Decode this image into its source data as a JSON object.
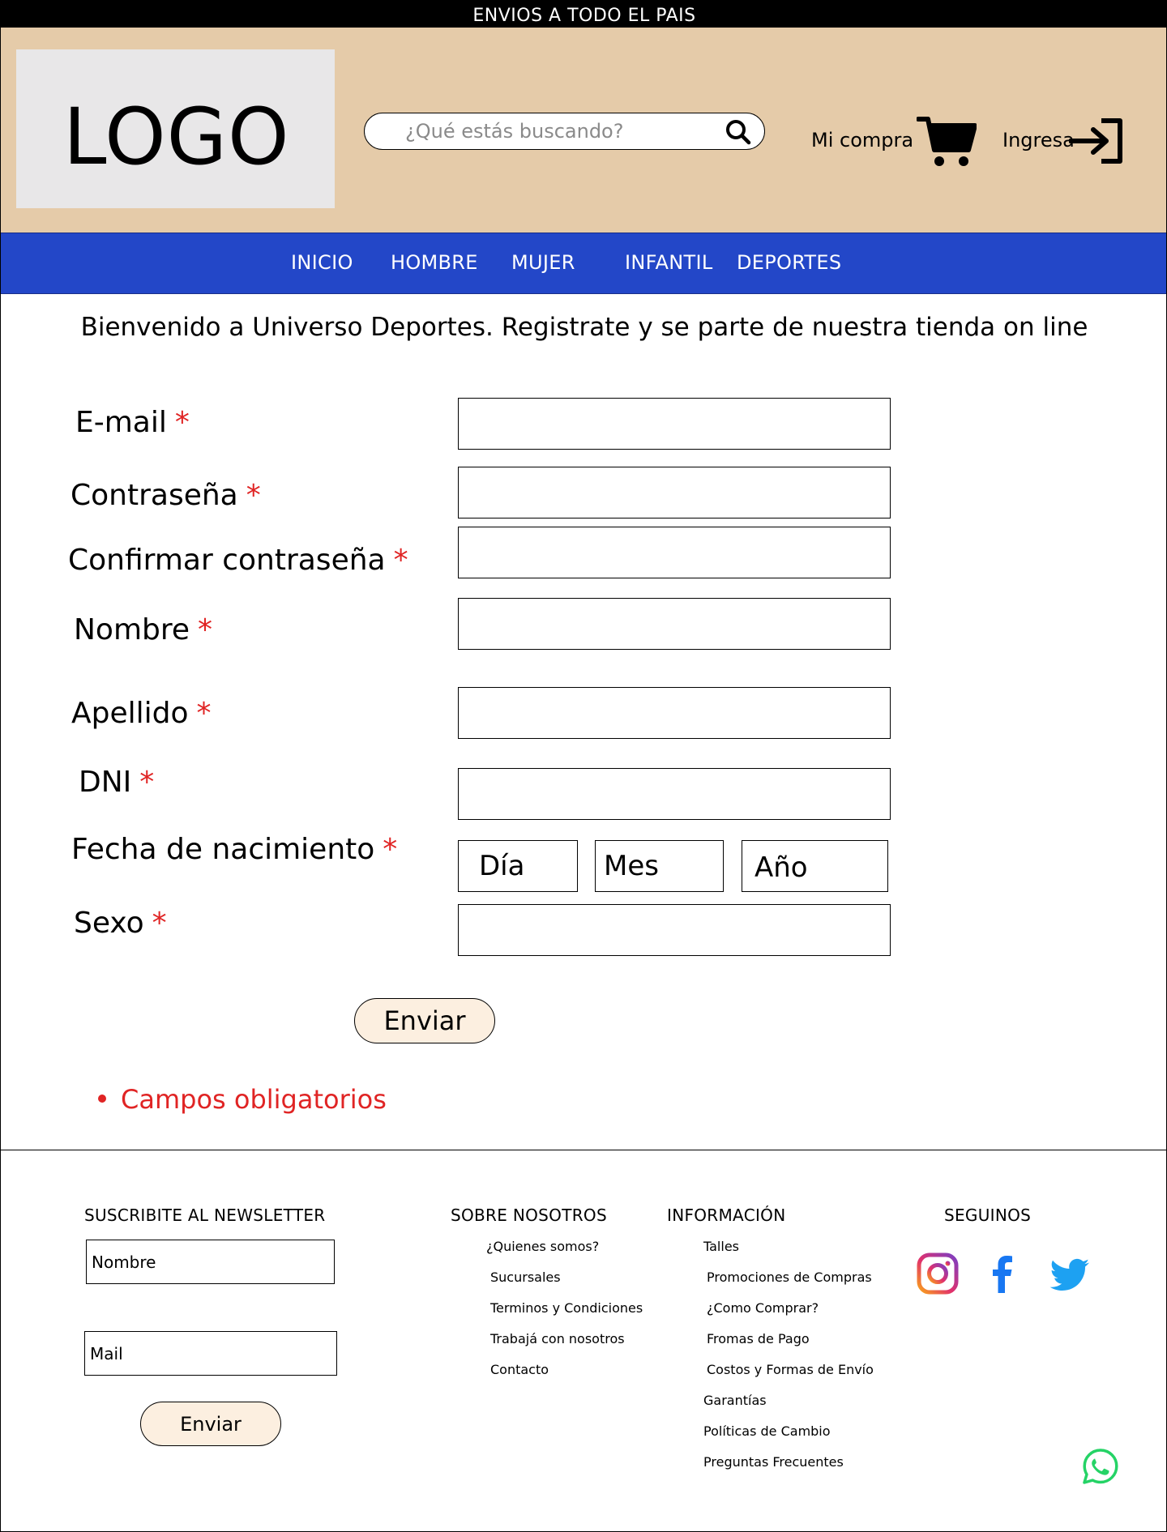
{
  "topbar": {
    "text": "ENVIOS A TODO EL PAIS"
  },
  "header": {
    "logo": "LOGO",
    "search_placeholder": "¿Qué estás buscando?",
    "cart_label": "Mi compra",
    "login_label": "Ingresa"
  },
  "nav": {
    "items": [
      {
        "label": "INICIO"
      },
      {
        "label": "HOMBRE"
      },
      {
        "label": "MUJER"
      },
      {
        "label": "INFANTIL"
      },
      {
        "label": "DEPORTES"
      }
    ]
  },
  "welcome": "Bienvenido a Universo Deportes. Registrate y se parte de nuestra tienda on line",
  "form": {
    "required_mark": "*",
    "fields": [
      {
        "label": "E-mail"
      },
      {
        "label": "Contraseña"
      },
      {
        "label": "Confirmar contraseña"
      },
      {
        "label": "Nombre"
      },
      {
        "label": "Apellido"
      },
      {
        "label": "DNI"
      },
      {
        "label": "Fecha de nacimiento"
      },
      {
        "label": "Sexo"
      }
    ],
    "date": {
      "day": "Día",
      "month": "Mes",
      "year": "Año"
    },
    "submit": "Enviar",
    "required_note": "Campos obligatorios"
  },
  "footer": {
    "newsletter": {
      "title": "SUSCRIBITE AL NEWSLETTER",
      "name_placeholder": "Nombre",
      "mail_placeholder": "Mail",
      "button": "Enviar"
    },
    "about": {
      "title": "SOBRE NOSOTROS",
      "links": [
        "¿Quienes somos?",
        "Sucursales",
        "Terminos y Condiciones",
        "Trabajá con nosotros",
        "Contacto"
      ]
    },
    "info": {
      "title": "INFORMACIÓN",
      "links": [
        "Talles",
        "Promociones de Compras",
        "¿Como Comprar?",
        "Fromas de Pago",
        "Costos y Formas de Envío",
        "Garantías",
        "Políticas de Cambio",
        "Preguntas Frecuentes"
      ]
    },
    "social": {
      "title": "SEGUINOS",
      "icons": [
        "instagram-icon",
        "facebook-icon",
        "twitter-icon"
      ]
    },
    "whatsapp_icon": "whatsapp-icon"
  },
  "colors": {
    "header_bg": "#e5cba9",
    "nav_bg": "#2347c8",
    "required": "#e02424",
    "button_bg": "#fcefe0",
    "whatsapp": "#25d366"
  }
}
